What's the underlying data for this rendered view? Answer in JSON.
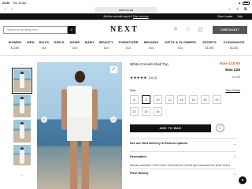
{
  "status_bar": {
    "time": "23:36",
    "date": "Thu 16 Apr",
    "signal": "▲",
    "battery_icon": "battery-icon"
  },
  "browser": {
    "url": "next.co.uk",
    "back": "‹",
    "forward": "›",
    "share": "↑",
    "add_tab": "+",
    "tabs": "⧉"
  },
  "promo": {
    "message": "Spill the ",
    "message_link_text": "cost with pay in 3",
    "message_link2": "Find out more",
    "store_locator": "Store Locator",
    "help": "Help"
  },
  "header": {
    "logo": "NEXT",
    "search_placeholder": "Search for anything here...",
    "search_icon": "⌕",
    "checkout_label": "CHECKOUT",
    "icons": {
      "account": "☺",
      "favourites": "♡",
      "bag": "▢"
    }
  },
  "nav": [
    {
      "label": "WOMEN",
      "price": "£12.50"
    },
    {
      "label": "MEN",
      "price": ""
    },
    {
      "label": "BOYS",
      "price": "£10"
    },
    {
      "label": "GIRLS",
      "price": ""
    },
    {
      "label": "HOME",
      "price": "£14"
    },
    {
      "label": "BABY",
      "price": ""
    },
    {
      "label": "BEAUTY",
      "price": "£14"
    },
    {
      "label": "FURNITURE",
      "price": "£14"
    },
    {
      "label": "BRANDS",
      "price": "£14"
    },
    {
      "label": "GIFTS & FLOWERS",
      "price": "£14"
    },
    {
      "label": "SPORTS",
      "price": "£12.50"
    },
    {
      "label": "CLEARANCE",
      "price": "£12.50"
    }
  ],
  "gallery": {
    "thumb_count": 4,
    "up": "⌃",
    "down": "⌄",
    "prev": "‹",
    "next": "›",
    "zoom": "⤢"
  },
  "product": {
    "title": "White Cornelli Shell Top",
    "price_now": "Now £10.50",
    "price_was": "Was £26",
    "saving": "£12.50",
    "stars": "★★★★★",
    "rating": "4.8 (3)",
    "size_label": "Size:",
    "size_guide": "Size Guide",
    "sizes": [
      "6",
      "8",
      "10",
      "12",
      "14",
      "16",
      "18",
      "20",
      "22",
      "24",
      "26"
    ],
    "selected_size": "8",
    "add_to_bag": "ADD TO BAG",
    "favourite_icon": "♡",
    "accordion": [
      {
        "title": "See our Next Delivery & Returns options"
      },
      {
        "title": "Description"
      },
      {
        "title": "Price History"
      }
    ],
    "description_text": "Machine washable. 100% Cotton. Items with the cornelli type embroidered in sizes 18 and"
  },
  "chat_icon": "●"
}
